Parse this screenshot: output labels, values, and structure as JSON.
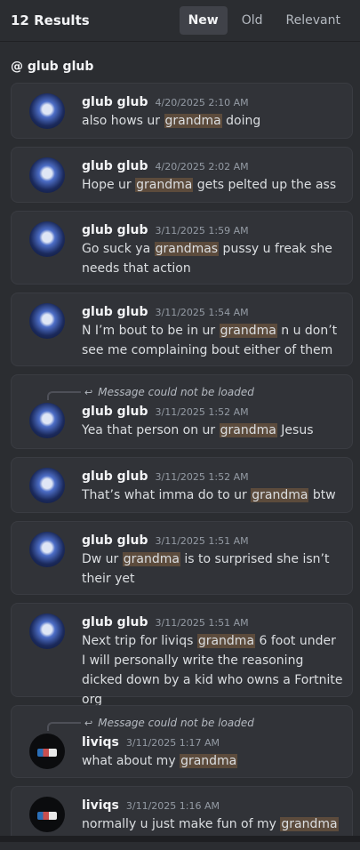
{
  "header": {
    "results_label": "12 Results",
    "sort_new": "New",
    "sort_old": "Old",
    "sort_relevant": "Relevant"
  },
  "channel": "@ glub glub",
  "reply_label": "Message could not be loaded",
  "messages": [
    {
      "author": "glub glub",
      "time": "4/20/2025 2:10 AM",
      "before": "also hows ur ",
      "hl": "grandma",
      "after": " doing"
    },
    {
      "author": "glub glub",
      "time": "4/20/2025 2:02 AM",
      "before": "Hope ur ",
      "hl": "grandma",
      "after": " gets pelted up the ass"
    },
    {
      "author": "glub glub",
      "time": "3/11/2025 1:59 AM",
      "before": "Go suck ya ",
      "hl": "grandmas",
      "after": " pussy u freak she needs that action"
    },
    {
      "author": "glub glub",
      "time": "3/11/2025 1:54 AM",
      "before": "N I’m bout to be in ur ",
      "hl": "grandma",
      "after": " n u don’t see me complaining bout either of them"
    },
    {
      "author": "glub glub",
      "time": "3/11/2025 1:52 AM",
      "before": "Yea that person on ur ",
      "hl": "grandma",
      "after": " Jesus"
    },
    {
      "author": "glub glub",
      "time": "3/11/2025 1:52 AM",
      "before": "That’s what imma do to ur ",
      "hl": "grandma",
      "after": " btw"
    },
    {
      "author": "glub glub",
      "time": "3/11/2025 1:51 AM",
      "before": "Dw ur ",
      "hl": "grandma",
      "after": " is to surprised she isn’t their yet"
    },
    {
      "author": "glub glub",
      "time": "3/11/2025 1:51 AM",
      "before": "Next trip for liviqs ",
      "hl": "grandma",
      "after": " 6 foot under I will personally write the reasoning dicked down by a kid who owns a Fortnite org"
    },
    {
      "author": "liviqs",
      "time": "3/11/2025 1:17 AM",
      "before": "what about my ",
      "hl": "grandma",
      "after": ""
    },
    {
      "author": "liviqs",
      "time": "3/11/2025 1:16 AM",
      "before": "normally u just make fun of my ",
      "hl": "grandma",
      "after": ""
    }
  ]
}
